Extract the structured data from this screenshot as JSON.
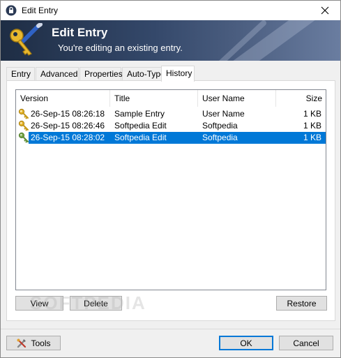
{
  "window": {
    "title": "Edit Entry"
  },
  "banner": {
    "title": "Edit Entry",
    "subtitle": "You're editing an existing entry."
  },
  "tabs": [
    {
      "label": "Entry"
    },
    {
      "label": "Advanced"
    },
    {
      "label": "Properties"
    },
    {
      "label": "Auto-Type"
    },
    {
      "label": "History",
      "active": true
    }
  ],
  "history": {
    "columns": {
      "version": "Version",
      "title": "Title",
      "user": "User Name",
      "size": "Size"
    },
    "rows": [
      {
        "version": "26-Sep-15 08:26:18",
        "title": "Sample Entry",
        "user": "User Name",
        "size": "1 KB",
        "selected": false
      },
      {
        "version": "26-Sep-15 08:26:46",
        "title": "Softpedia Edit",
        "user": "Softpedia",
        "size": "1 KB",
        "selected": false
      },
      {
        "version": "26-Sep-15 08:28:02",
        "title": "Softpedia Edit",
        "user": "Softpedia",
        "size": "1 KB",
        "selected": true
      }
    ],
    "buttons": {
      "view": "View",
      "delete": "Delete",
      "restore": "Restore"
    }
  },
  "footer": {
    "tools": "Tools",
    "ok": "OK",
    "cancel": "Cancel"
  },
  "watermark": "SOFTPEDIA",
  "colors": {
    "selection": "#0078d7",
    "banner_dark": "#1e2d44",
    "key_gold": "#e8b82e",
    "key_green": "#79a84a"
  }
}
